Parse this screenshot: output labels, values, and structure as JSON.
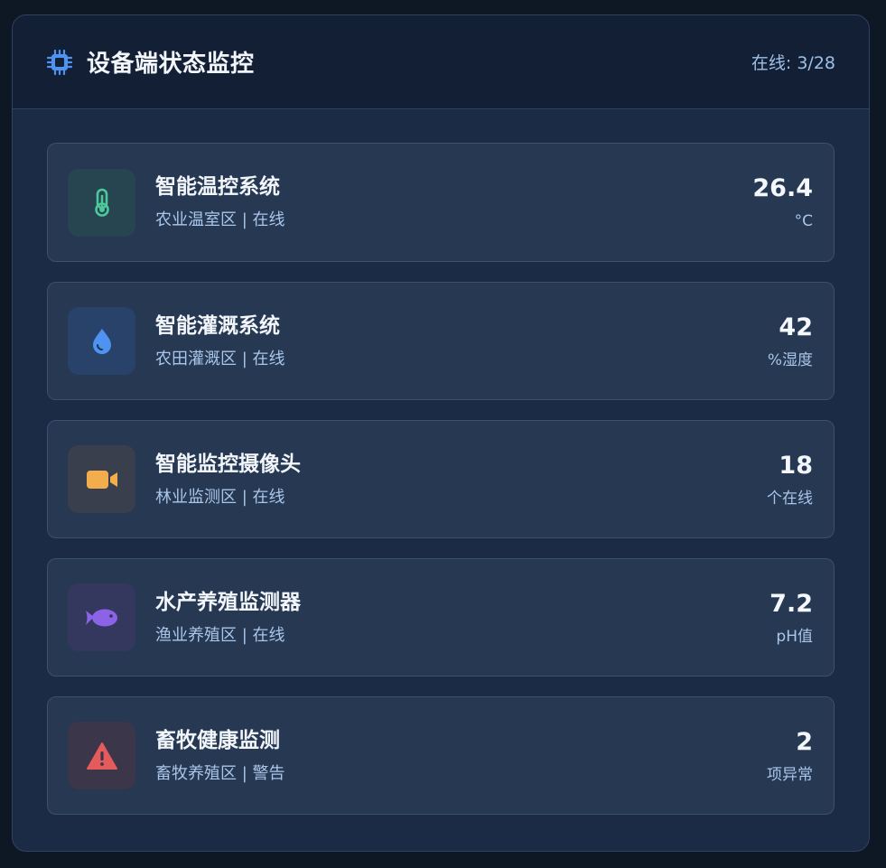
{
  "header": {
    "icon": "chip-icon",
    "title": "设备端状态监控",
    "online_count": "在线: 3/28"
  },
  "devices": [
    {
      "icon": "thermometer-icon",
      "icon_color": "#4cc99a",
      "icon_bg": "#264551",
      "name": "智能温控系统",
      "meta": "农业温室区 | 在线",
      "value": "26.4",
      "unit": "°C"
    },
    {
      "icon": "water-drop-icon",
      "icon_color": "#4e93f0",
      "icon_bg": "#29426a",
      "name": "智能灌溉系统",
      "meta": "农田灌溉区 | 在线",
      "value": "42",
      "unit": "%湿度"
    },
    {
      "icon": "video-camera-icon",
      "icon_color": "#f3ad4c",
      "icon_bg": "#393f4d",
      "name": "智能监控摄像头",
      "meta": "林业监测区 | 在线",
      "value": "18",
      "unit": "个在线"
    },
    {
      "icon": "fish-icon",
      "icon_color": "#8c62e6",
      "icon_bg": "#34385f",
      "name": "水产养殖监测器",
      "meta": "渔业养殖区 | 在线",
      "value": "7.2",
      "unit": "pH值"
    },
    {
      "icon": "warning-icon",
      "icon_color": "#e35b5b",
      "icon_bg": "#3b3649",
      "name": "畜牧健康监测",
      "meta": "畜牧养殖区 | 警告",
      "value": "2",
      "unit": "项异常"
    }
  ]
}
